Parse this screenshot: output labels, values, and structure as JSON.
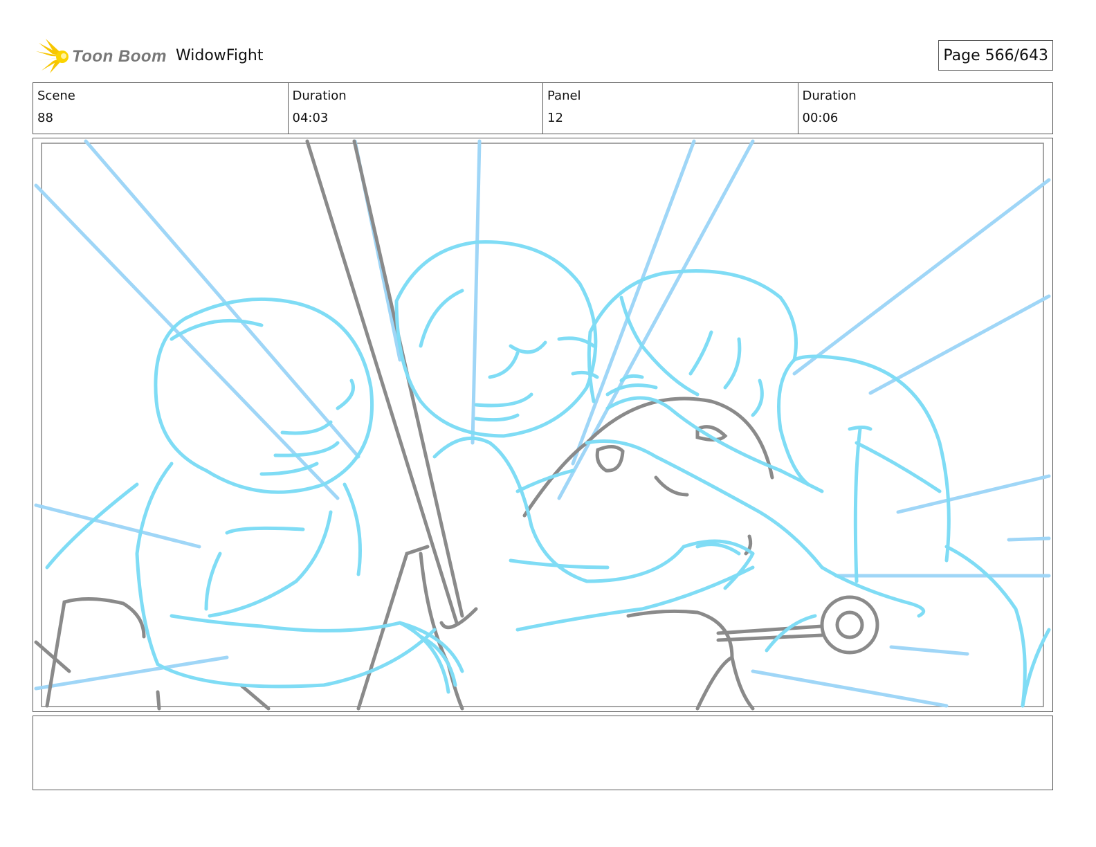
{
  "header": {
    "logo_text": "Toon Boom",
    "project_title": "WidowFight",
    "page_label": "Page 566/643"
  },
  "info": {
    "scene_label": "Scene",
    "scene_value": "88",
    "scene_duration_label": "Duration",
    "scene_duration_value": "04:03",
    "panel_label": "Panel",
    "panel_value": "12",
    "panel_duration_label": "Duration",
    "panel_duration_value": "00:06"
  },
  "colors": {
    "sketch_blue": "#7fdcf5",
    "sketch_blue_light": "#9fd6f7",
    "sketch_gray": "#8a8a8a",
    "logo_yellow": "#f7c600"
  },
  "icons": {
    "logo": "toon-boom-starburst-icon"
  },
  "notes": {
    "text": ""
  }
}
